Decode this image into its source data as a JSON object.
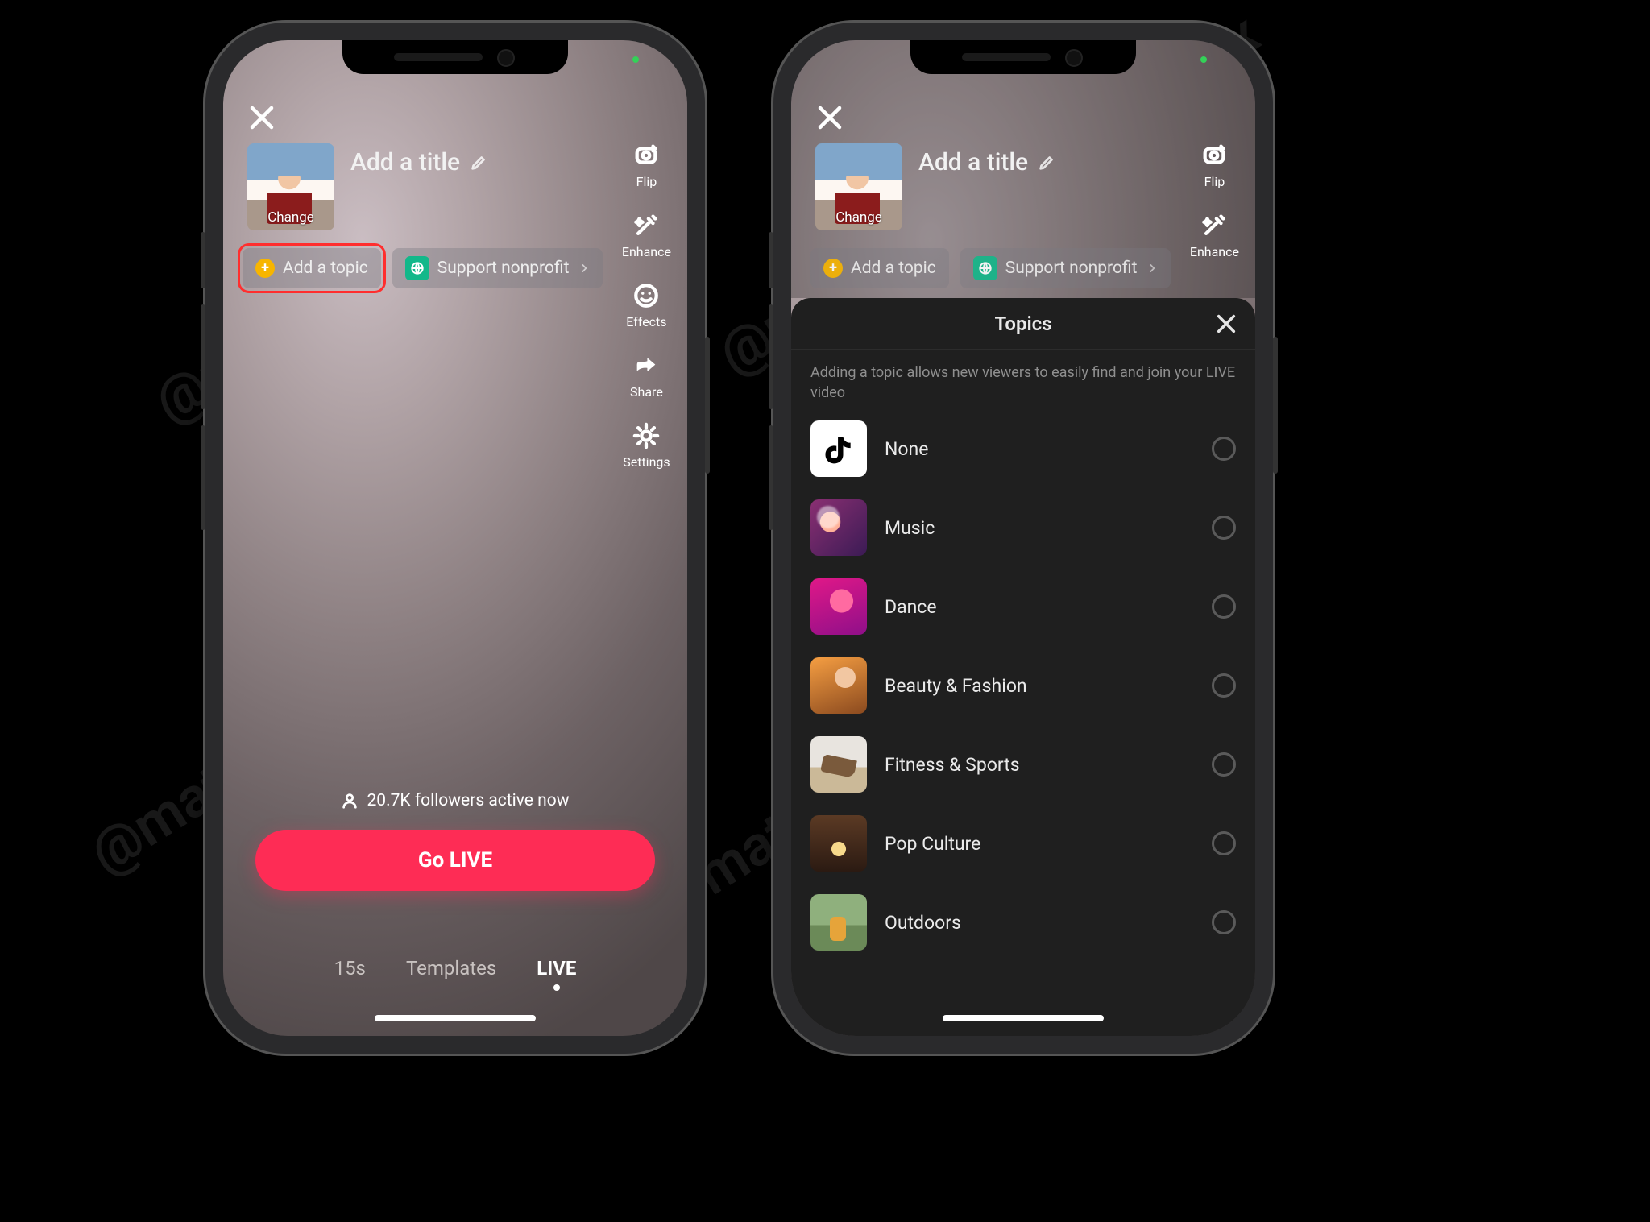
{
  "watermark_text": "@mattnavarra / @sphinx",
  "left": {
    "cover_label": "Change",
    "title_placeholder": "Add a title",
    "pills": {
      "add_topic": "Add a topic",
      "support_nonprofit": "Support nonprofit"
    },
    "rail": {
      "flip": "Flip",
      "enhance": "Enhance",
      "effects": "Effects",
      "share": "Share",
      "settings": "Settings"
    },
    "followers": "20.7K followers active now",
    "go_live": "Go LIVE",
    "tabs": {
      "fifteen": "15s",
      "templates": "Templates",
      "live": "LIVE"
    }
  },
  "right": {
    "cover_label": "Change",
    "title_placeholder": "Add a title",
    "pills": {
      "add_topic": "Add a topic",
      "support_nonprofit": "Support nonprofit"
    },
    "rail": {
      "flip": "Flip",
      "enhance": "Enhance"
    },
    "sheet": {
      "title": "Topics",
      "desc": "Adding a topic allows new viewers to easily find and join your LIVE video",
      "items": [
        {
          "name": "None"
        },
        {
          "name": "Music"
        },
        {
          "name": "Dance"
        },
        {
          "name": "Beauty & Fashion"
        },
        {
          "name": "Fitness & Sports"
        },
        {
          "name": "Pop Culture"
        },
        {
          "name": "Outdoors"
        }
      ]
    }
  }
}
